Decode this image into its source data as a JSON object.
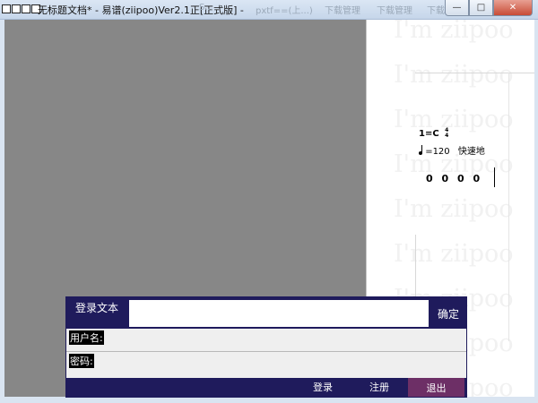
{
  "window": {
    "title": "无标题文档* - 易谱(ziipoo)Ver2.1正[正式版] -",
    "taskbar_ghost": [
      "S...",
      "pxtf==(上...)",
      "下载管理",
      "下载管理",
      "下载管理"
    ],
    "controls": {
      "minimize": "—",
      "maximize": "□",
      "close": "✕"
    }
  },
  "score": {
    "watermark": "I'm ziipoo",
    "key": "1=C",
    "time_signature": {
      "top": "4",
      "bottom": "4"
    },
    "tempo_value": "=120",
    "tempo_text": "快速地",
    "notes": "0 0 0 0"
  },
  "login": {
    "title": "登录文本",
    "confirm": "确定",
    "username_label": "用户名:",
    "password_label": "密码:",
    "login": "登录",
    "register": "注册",
    "exit": "退出"
  },
  "colors": {
    "dialog_header": "#1f1b5c",
    "exit_button": "#6d2f66",
    "editor_gray": "#878787"
  }
}
